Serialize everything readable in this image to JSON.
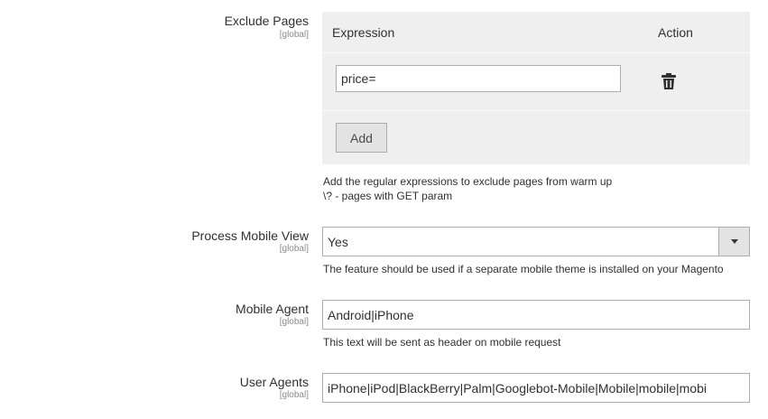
{
  "exclude_pages": {
    "label": "Exclude Pages",
    "scope": "[global]",
    "col_expression": "Expression",
    "col_action": "Action",
    "rows": [
      {
        "expression": "price=",
        "action_icon": "trash-icon"
      }
    ],
    "add_label": "Add",
    "note_line1": "Add the regular expressions to exclude pages from warm up",
    "note_line2": "\\? - pages with GET param"
  },
  "process_mobile_view": {
    "label": "Process Mobile View",
    "scope": "[global]",
    "selected": "Yes",
    "arrow_icon": "chevron-down-icon",
    "note": "The feature should be used if a separate mobile theme is installed on your Magento"
  },
  "mobile_agent": {
    "label": "Mobile Agent",
    "scope": "[global]",
    "value": "Android|iPhone",
    "note": "This text will be sent as header on mobile request"
  },
  "user_agents": {
    "label": "User Agents",
    "scope": "[global]",
    "value": "iPhone|iPod|BlackBerry|Palm|Googlebot-Mobile|Mobile|mobile|mobi"
  }
}
